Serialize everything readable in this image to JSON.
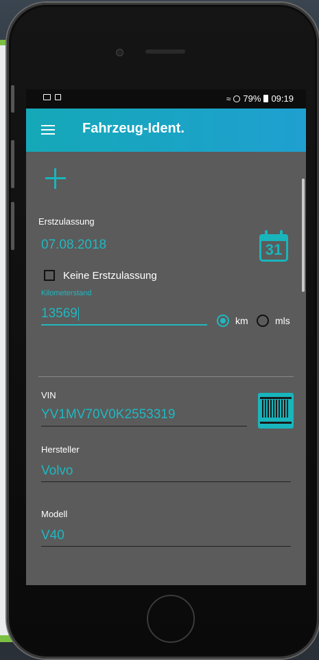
{
  "status_bar": {
    "battery": "79%",
    "time": "09:19",
    "left_icons": [
      "gallery-icon",
      "screenshot-icon"
    ],
    "right_icons": [
      "wifi-icon",
      "do-not-disturb-icon",
      "battery-icon"
    ]
  },
  "app_bar": {
    "title": "Fahrzeug-Ident.",
    "menu_icon": "hamburger-menu-icon"
  },
  "form": {
    "erstzulassung_label": "Erstzulassung",
    "erstzulassung_value": "07.08.2018",
    "calendar_day": "31",
    "keine_erstzulassung_label": "Keine Erstzulassung",
    "keine_erstzulassung_checked": false,
    "km_label": "Kilometerstand",
    "km_value": "13569",
    "unit_km": "km",
    "unit_mls": "mls",
    "selected_unit": "km",
    "vin_label": "VIN",
    "vin_value": "YV1MV70V0K2553319",
    "hersteller_label": "Hersteller",
    "hersteller_value": "Volvo",
    "modell_label": "Modell",
    "modell_value": "V40"
  },
  "colors": {
    "accent": "#1fb8c1",
    "appbar_start": "#15a8b8",
    "appbar_end": "#1fa0d0",
    "screen_bg": "#5b5b5b"
  }
}
